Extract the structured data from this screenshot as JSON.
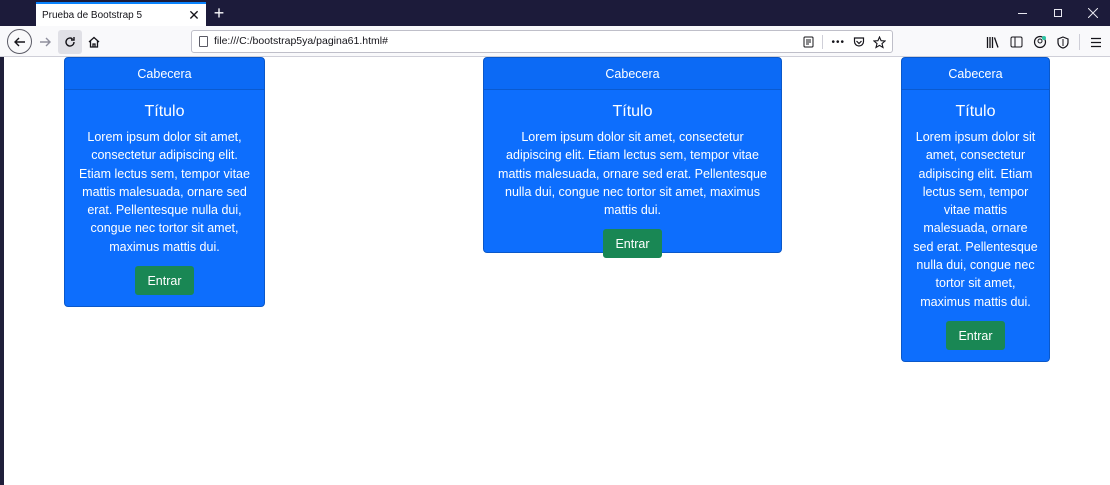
{
  "browser": {
    "tab_title": "Prueba de Bootstrap 5",
    "tab_close": "✕",
    "new_tab": "+",
    "url": "file:///C:/bootstrap5ya/pagina61.html#",
    "url_icons": {
      "menu_dots": "•••"
    }
  },
  "cards": [
    {
      "header": "Cabecera",
      "title": "Título",
      "text": "Lorem ipsum dolor sit amet, consectetur adipiscing elit. Etiam lectus sem, tempor vitae mattis malesuada, ornare sed erat. Pellentesque nulla dui, congue nec tortor sit amet, maximus mattis dui.",
      "button": "Entrar"
    },
    {
      "header": "Cabecera",
      "title": "Título",
      "text": "Lorem ipsum dolor sit amet, consectetur adipiscing elit. Etiam lectus sem, tempor vitae mattis malesuada, ornare sed erat. Pellentesque nulla dui, congue nec tortor sit amet, maximus mattis dui.",
      "button": "Entrar"
    },
    {
      "header": "Cabecera",
      "title": "Título",
      "text": "Lorem ipsum dolor sit amet, consectetur adipiscing elit. Etiam lectus sem, tempor vitae mattis malesuada, ornare sed erat. Pellentesque nulla dui, congue nec tortor sit amet, maximus mattis dui.",
      "button": "Entrar"
    }
  ],
  "colors": {
    "card_primary": "#0d6efd",
    "button_success": "#198754",
    "titlebar": "#1c1b3a"
  }
}
